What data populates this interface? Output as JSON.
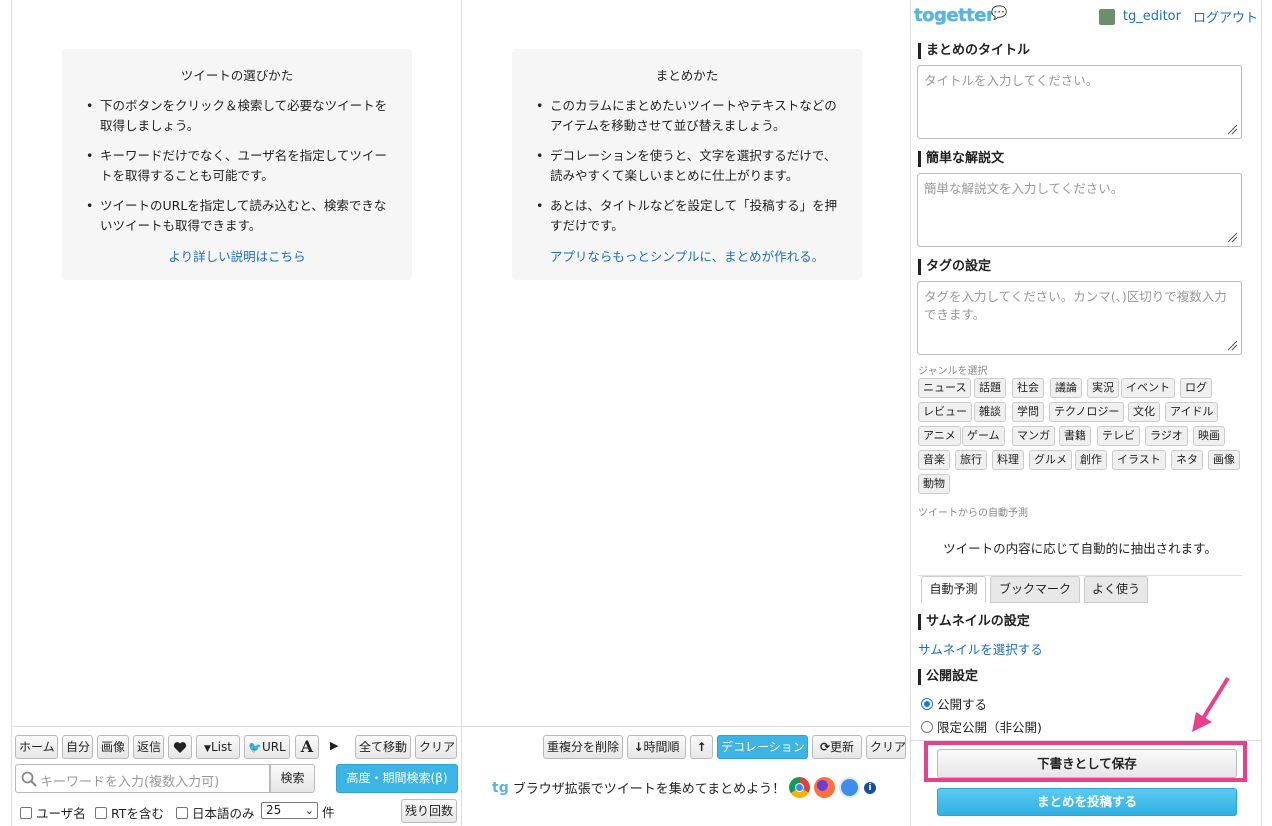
{
  "left_help": {
    "title": "ツイートの選びかた",
    "items": [
      "下のボタンをクリック＆検索して必要なツイートを取得しましょう。",
      "キーワードだけでなく、ユーザ名を指定してツイートを取得することも可能です。",
      "ツイートのURLを指定して読み込むと、検索できないツイートも取得できます。"
    ],
    "link": "より詳しい説明はこちら"
  },
  "mid_help": {
    "title": "まとめかた",
    "items": [
      "このカラムにまとめたいツイートやテキストなどのアイテムを移動させて並び替えましょう。",
      "デコレーションを使うと、文字を選択するだけで、読みやすくて楽しいまとめに仕上がります。",
      "あとは、タイトルなどを設定して「投稿する」を押すだけです。"
    ],
    "link": "アプリならもっとシンプルに、まとめが作れる。"
  },
  "left_toolbar": {
    "home": "ホーム",
    "self": "自分",
    "image": "画像",
    "reply": "返信",
    "list": "List",
    "url": "URL",
    "font": "A",
    "move_all": "全て移動",
    "clear": "クリア",
    "search_placeholder": "キーワードを入力(複数入力可)",
    "search": "検索",
    "advanced_search": "高度・期間検索(β)",
    "user_name": "ユーザ名",
    "include_rt": "RTを含む",
    "japanese_only": "日本語のみ",
    "count_value": "25",
    "count_unit": "件",
    "remaining": "残り回数"
  },
  "mid_toolbar": {
    "remove_dupes": "重複分を削除",
    "time_order": "時間順",
    "decoration": "デコレーション",
    "refresh": "更新",
    "clear": "クリア",
    "extension_text": "ブラウザ拡張でツイートを集めてまとめよう！"
  },
  "header": {
    "logo": "togetter",
    "username": "tg_editor",
    "logout": "ログアウト"
  },
  "form": {
    "title_label": "まとめのタイトル",
    "title_placeholder": "タイトルを入力してください。",
    "desc_label": "簡単な解説文",
    "desc_placeholder": "簡単な解説文を入力してください。",
    "tag_label": "タグの設定",
    "tag_placeholder": "タグを入力してください。カンマ(、)区切りで複数入力できます。",
    "genre_label": "ジャンルを選択",
    "genres": [
      "ニュース",
      "話題",
      "社会",
      "議論",
      "実況",
      "イベント",
      "ログ",
      "レビュー",
      "雑談",
      "学問",
      "テクノロジー",
      "文化",
      "アイドル",
      "アニメ",
      "ゲーム",
      "マンガ",
      "書籍",
      "テレビ",
      "ラジオ",
      "映画",
      "音楽",
      "旅行",
      "料理",
      "グルメ",
      "創作",
      "イラスト",
      "ネタ",
      "画像",
      "動物"
    ],
    "auto_label": "ツイートからの自動予測",
    "auto_text": "ツイートの内容に応じて自動的に抽出されます。",
    "tabs": [
      "自動予測",
      "ブックマーク",
      "よく使う"
    ],
    "thumb_label": "サムネイルの設定",
    "thumb_link": "サムネイルを選択する",
    "publish_label": "公開設定",
    "public": "公開する",
    "limited": "限定公開（非公開)",
    "save_draft": "下書きとして保存",
    "post": "まとめを投稿する"
  },
  "colors": {
    "accent": "#3db4e6",
    "highlight": "#e8408a",
    "link": "#1b6ec2"
  }
}
